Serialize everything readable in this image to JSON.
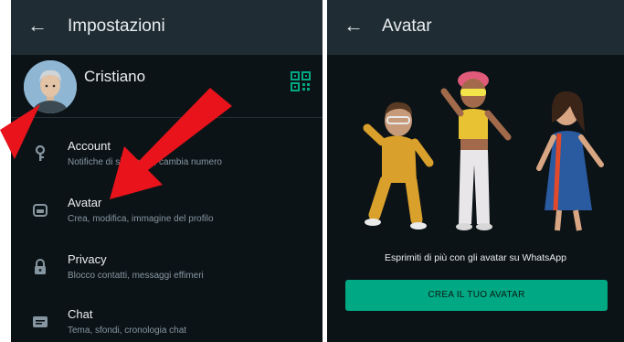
{
  "settings": {
    "title": "Impostazioni",
    "profile_name": "Cristiano",
    "items": [
      {
        "title": "Account",
        "subtitle": "Notifiche di sicurezza, cambia numero",
        "icon": "key-icon"
      },
      {
        "title": "Avatar",
        "subtitle": "Crea, modifica, immagine del profilo",
        "icon": "avatar-icon"
      },
      {
        "title": "Privacy",
        "subtitle": "Blocco contatti, messaggi effimeri",
        "icon": "lock-icon"
      },
      {
        "title": "Chat",
        "subtitle": "Tema, sfondi, cronologia chat",
        "icon": "chat-icon"
      }
    ]
  },
  "avatar_screen": {
    "title": "Avatar",
    "tagline": "Esprimiti di più con gli avatar su WhatsApp",
    "create_button": "CREA IL TUO AVATAR"
  },
  "colors": {
    "background": "#0c1317",
    "app_bar": "#1f2c34",
    "accent_green": "#00a884",
    "arrow_red": "#e8131b"
  }
}
